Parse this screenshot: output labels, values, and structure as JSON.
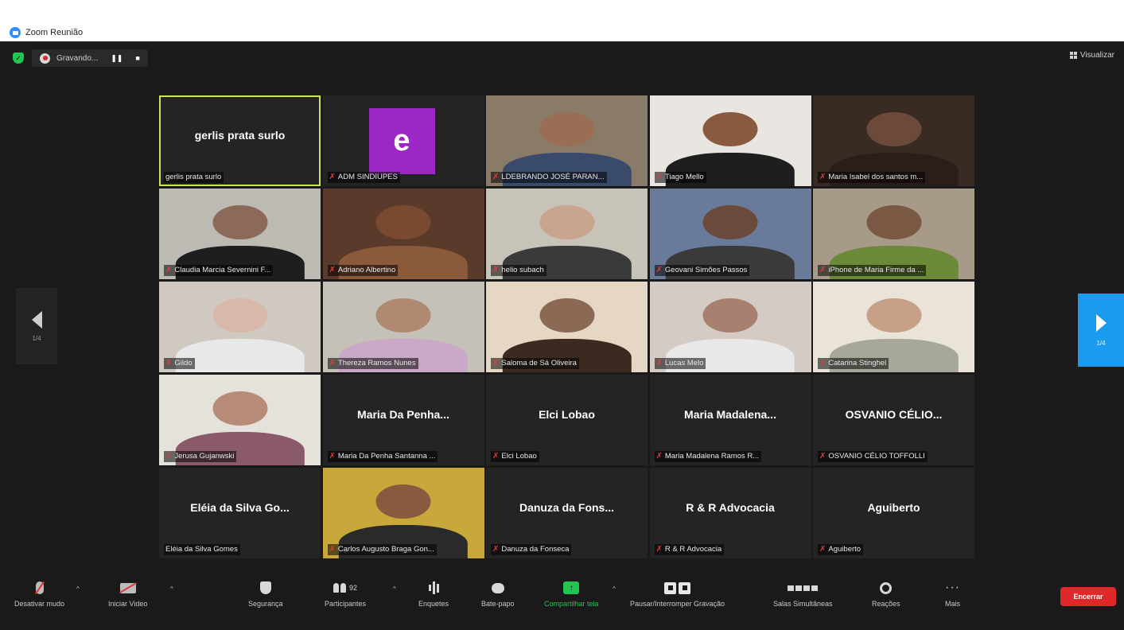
{
  "window": {
    "title": "Zoom Reunião"
  },
  "topbar": {
    "recording_text": "Gravando...",
    "view_label": "Visualizar"
  },
  "pagination": {
    "left_page": "1/4",
    "right_page": "1/4"
  },
  "tiles": [
    {
      "kind": "name",
      "display": "gerlis prata surlo",
      "label": "gerlis prata surlo",
      "muted": false,
      "active": true
    },
    {
      "kind": "avatar",
      "initial": "e",
      "label": "ADM SINDIUPES",
      "muted": true,
      "color": "#9b27c6"
    },
    {
      "kind": "video",
      "label": "LDEBRANDO JOSÉ PARAN...",
      "muted": true,
      "bg": "#8a7a68",
      "skin": "#9a6e55",
      "shirt": "#3a4a6a"
    },
    {
      "kind": "video",
      "label": "Tiago Mello",
      "muted": true,
      "bg": "#e9e6e2",
      "skin": "#8a5a40",
      "shirt": "#1e1e1e"
    },
    {
      "kind": "video",
      "label": "Maria Isabel dos santos m...",
      "muted": true,
      "bg": "#3a2a24",
      "skin": "#6b4a3a",
      "shirt": "#2a1e1a"
    },
    {
      "kind": "video",
      "label": "Claudia Marcia Severnini F...",
      "muted": true,
      "bg": "#bdbab4",
      "skin": "#8b6a5a",
      "shirt": "#1e1e1e"
    },
    {
      "kind": "video",
      "label": "Adriano Albertino",
      "muted": true,
      "bg": "#5a3a2a",
      "skin": "#7a4a30",
      "shirt": "#8a5a3a"
    },
    {
      "kind": "video",
      "label": "helio subach",
      "muted": true,
      "bg": "#c7c3b8",
      "skin": "#c9a590",
      "shirt": "#3a3a3a"
    },
    {
      "kind": "video",
      "label": "Geovani Simões Passos",
      "muted": true,
      "bg": "#6a7a9a",
      "skin": "#6a4a3a",
      "shirt": "#3a3a3a"
    },
    {
      "kind": "video",
      "label": "iPhone de Maria Firme da ...",
      "muted": true,
      "bg": "#a89a88",
      "skin": "#7a5a45",
      "shirt": "#6a8a3a"
    },
    {
      "kind": "video",
      "label": "Gildo",
      "muted": true,
      "bg": "#cfc9c2",
      "skin": "#d8b8a8",
      "shirt": "#e8e8e8"
    },
    {
      "kind": "video",
      "label": "Thereza Ramos Nunes",
      "muted": true,
      "bg": "#c6c1b8",
      "skin": "#b08a70",
      "shirt": "#c9a8c8"
    },
    {
      "kind": "video",
      "label": "Saloma de Sá Oliveira",
      "muted": true,
      "bg": "#e6d7c4",
      "skin": "#8a6a55",
      "shirt": "#3a2a20"
    },
    {
      "kind": "video",
      "label": "Lucas Melo",
      "muted": true,
      "bg": "#d4cbc4",
      "skin": "#a88070",
      "shirt": "#e8e8e8"
    },
    {
      "kind": "video",
      "label": "Catarina Stinghel",
      "muted": true,
      "bg": "#e9e3d8",
      "skin": "#c8a088",
      "shirt": "#a8a89a"
    },
    {
      "kind": "video",
      "label": "Jerusa Gujanwski",
      "muted": true,
      "bg": "#e5e2dc",
      "skin": "#b88a78",
      "shirt": "#8a5a6a"
    },
    {
      "kind": "name",
      "display": "Maria Da Penha...",
      "label": "Maria Da Penha Santanna ...",
      "muted": true
    },
    {
      "kind": "name",
      "display": "Elci Lobao",
      "label": "Elci Lobao",
      "muted": true
    },
    {
      "kind": "name",
      "display": "Maria Madalena...",
      "label": "Maria Madalena Ramos R...",
      "muted": true
    },
    {
      "kind": "name",
      "display": "OSVANIO CÉLIO...",
      "label": "OSVANIO CÉLIO TOFFOLLI",
      "muted": true
    },
    {
      "kind": "name",
      "display": "Eléia da Silva Go...",
      "label": "Eléia da Silva Gomes",
      "muted": false
    },
    {
      "kind": "video",
      "label": "Carlos Augusto Braga Gon...",
      "muted": true,
      "bg": "#c8a83a",
      "skin": "#8a5a40",
      "shirt": "#2a2a2a"
    },
    {
      "kind": "name",
      "display": "Danuza da Fons...",
      "label": "Danuza da Fonseca",
      "muted": true
    },
    {
      "kind": "name",
      "display": "R & R Advocacia",
      "label": "R & R Advocacia",
      "muted": true
    },
    {
      "kind": "name",
      "display": "Aguiberto",
      "label": "Aguiberto",
      "muted": true
    }
  ],
  "toolbar": {
    "mute_label": "Desativar mudo",
    "video_label": "Iniciar Video",
    "security_label": "Segurança",
    "participants_label": "Participantes",
    "participants_count": "92",
    "polls_label": "Enquetes",
    "chat_label": "Bate-papo",
    "share_label": "Compartilhar tela",
    "record_label": "Pausar/Interromper Gravação",
    "rooms_label": "Salas Simultâneas",
    "reactions_label": "Reações",
    "more_label": "Mais",
    "end_label": "Encerrar"
  },
  "colors": {
    "accent_blue": "#1b9bf0",
    "end_red": "#e02828",
    "share_green": "#23c552",
    "active_outline": "#c8e65a"
  }
}
